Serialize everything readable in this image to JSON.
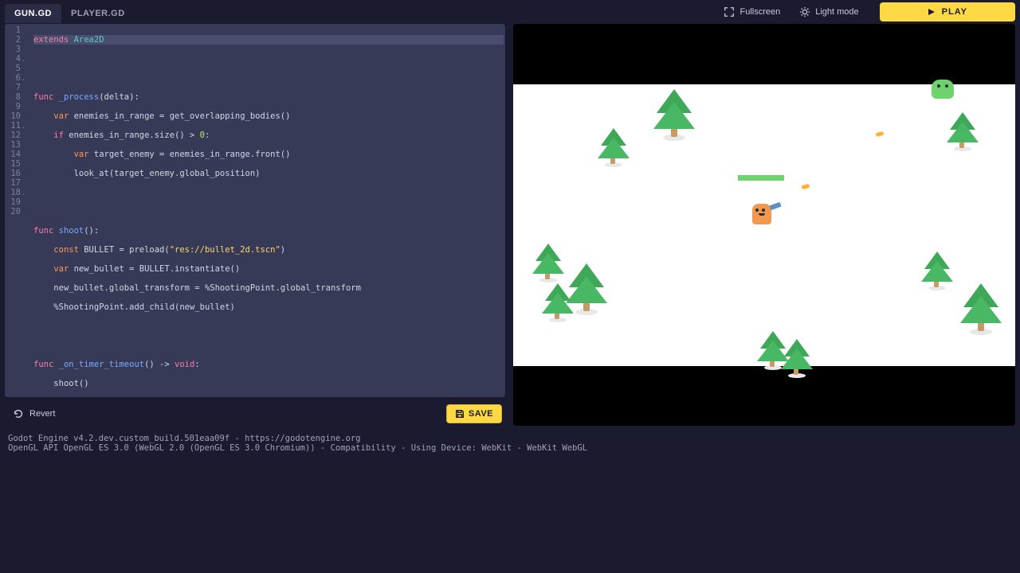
{
  "tabs": {
    "t0": "GUN.GD",
    "t1": "PLAYER.GD",
    "active": 0
  },
  "toolbar": {
    "fullscreen": "Fullscreen",
    "lightmode": "Light mode",
    "play": "PLAY"
  },
  "editor": {
    "line_count": 20,
    "fold_lines": [
      4,
      6,
      11,
      18
    ],
    "footer": {
      "revert": "Revert",
      "save": "SAVE"
    }
  },
  "code": {
    "l1_kw": "extends",
    "l1_cls": "Area2D",
    "l4_kw": "func",
    "l4_name": "_process",
    "l4_args": "(delta):",
    "l5_kw": "var",
    "l5_rest": " enemies_in_range = get_overlapping_bodies()",
    "l6_kw": "if",
    "l6_a": " enemies_in_range.size() > ",
    "l6_num": "0",
    "l6_b": ":",
    "l7_kw": "var",
    "l7_rest": " target_enemy = enemies_in_range.front()",
    "l8": "look_at(target_enemy.global_position)",
    "l11_kw": "func",
    "l11_name": "shoot",
    "l11_args": "():",
    "l12_kw": "const",
    "l12_a": " BULLET = preload(",
    "l12_str": "\"res://bullet_2d.tscn\"",
    "l12_b": ")",
    "l13_kw": "var",
    "l13_rest": " new_bullet = BULLET.instantiate()",
    "l14": "new_bullet.global_transform = %ShootingPoint.global_transform",
    "l15": "%ShootingPoint.add_child(new_bullet)",
    "l18_kw": "func",
    "l18_name": "_on_timer_timeout",
    "l18_args": "() -> ",
    "l18_ret": "void",
    "l18_c": ":",
    "l19": "shoot()"
  },
  "console": {
    "l1": "Godot Engine v4.2.dev.custom_build.501eaa09f - https://godotengine.org",
    "l2": "OpenGL API OpenGL ES 3.0 (WebGL 2.0 (OpenGL ES 3.0 Chromium)) - Compatibility - Using Device: WebKit - WebKit WebGL"
  }
}
